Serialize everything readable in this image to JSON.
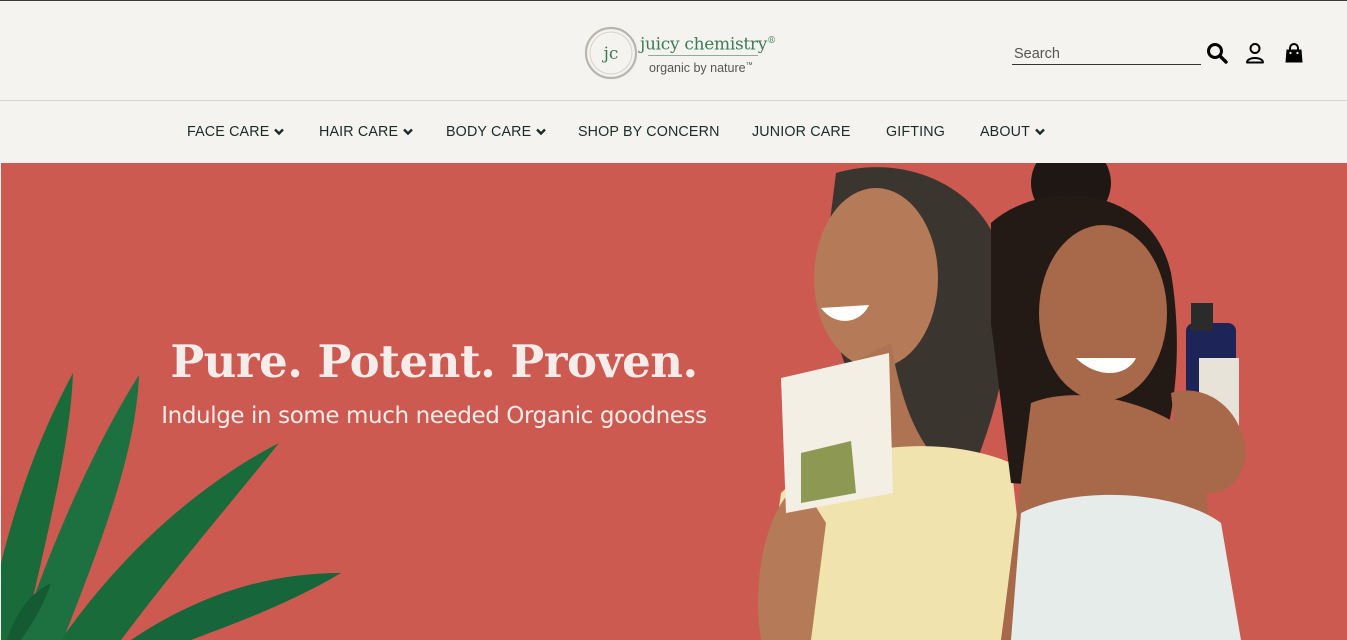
{
  "brand": {
    "initials": "jc",
    "name": "juicy chemistry",
    "registered": "®",
    "tagline": "organic by nature",
    "tagline_tm": "™",
    "color": "#3e7b55"
  },
  "header": {
    "search": {
      "placeholder": "Search",
      "value": ""
    },
    "icons": [
      "search-icon",
      "user-icon",
      "shopping-bag-icon"
    ]
  },
  "nav": {
    "items": [
      {
        "label": "FACE CARE",
        "dropdown": true
      },
      {
        "label": "HAIR CARE",
        "dropdown": true
      },
      {
        "label": "BODY CARE",
        "dropdown": true
      },
      {
        "label": "SHOP BY CONCERN",
        "dropdown": false
      },
      {
        "label": "JUNIOR CARE",
        "dropdown": false
      },
      {
        "label": "GIFTING",
        "dropdown": false
      },
      {
        "label": "ABOUT",
        "dropdown": true
      }
    ]
  },
  "hero": {
    "title": "Pure. Potent. Proven.",
    "subtitle": "Indulge in some much needed Organic goodness",
    "background": "#cd5a51",
    "leaf_color": "#1a6b3a"
  }
}
